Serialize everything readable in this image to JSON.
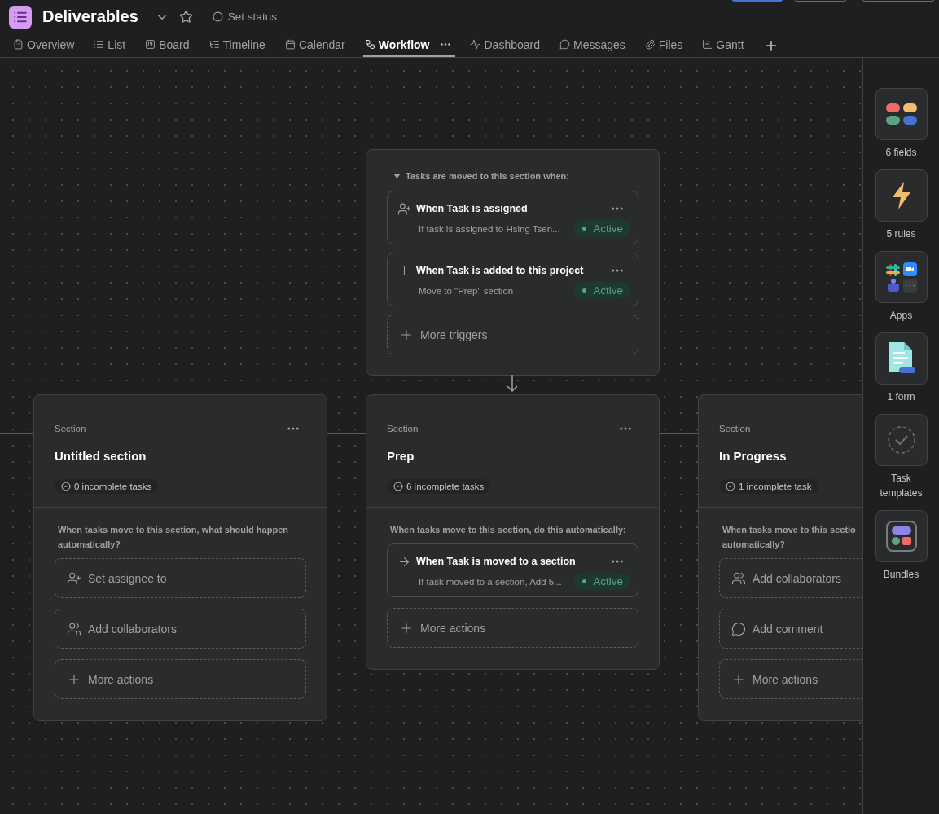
{
  "project": {
    "title": "Deliverables",
    "status_label": "Set status"
  },
  "tabs": [
    {
      "label": "Overview",
      "kind": "overview",
      "selected": false
    },
    {
      "label": "List",
      "kind": "list",
      "selected": false
    },
    {
      "label": "Board",
      "kind": "board",
      "selected": false
    },
    {
      "label": "Timeline",
      "kind": "timeline",
      "selected": false
    },
    {
      "label": "Calendar",
      "kind": "calendar",
      "selected": false
    },
    {
      "label": "Workflow",
      "kind": "workflow",
      "selected": true
    },
    {
      "label": "Dashboard",
      "kind": "dashboard",
      "selected": false
    },
    {
      "label": "Messages",
      "kind": "messages",
      "selected": false
    },
    {
      "label": "Files",
      "kind": "files",
      "selected": false
    },
    {
      "label": "Gantt",
      "kind": "gantt",
      "selected": false
    }
  ],
  "trigger_panel": {
    "heading": "Tasks are moved to this section when:",
    "expanded": true,
    "triggers": [
      {
        "kind": "assign",
        "title": "When Task is assigned",
        "description": "If task is assigned to Hsing Tsen...",
        "status": "Active"
      },
      {
        "kind": "add",
        "title": "When Task is added to this project",
        "description": "Move to \"Prep\" section",
        "status": "Active"
      }
    ],
    "more_label": "More triggers"
  },
  "sections": [
    {
      "label": "Section",
      "title": "Untitled section",
      "count": "0 incomplete tasks",
      "prompt": "When tasks move to this section, what should happen automatically?",
      "actions": [
        {
          "kind": "assignee",
          "label": "Set assignee to"
        },
        {
          "kind": "collaborators",
          "label": "Add collaborators"
        },
        {
          "kind": "more",
          "label": "More actions"
        }
      ]
    },
    {
      "label": "Section",
      "title": "Prep",
      "count": "6 incomplete tasks",
      "prompt": "When tasks move to this section, do this automatically:",
      "rules": [
        {
          "kind": "move",
          "title": "When Task is moved to a section",
          "description": "If task moved to a section, Add 5...",
          "status": "Active"
        }
      ],
      "actions": [
        {
          "kind": "more",
          "label": "More actions"
        }
      ]
    },
    {
      "label": "Section",
      "title": "In Progress",
      "count": "1 incomplete task",
      "prompt": "When tasks move to this sectio\nautomatically?",
      "actions": [
        {
          "kind": "collaborators",
          "label": "Add collaborators"
        },
        {
          "kind": "comment",
          "label": "Add comment"
        },
        {
          "kind": "more",
          "label": "More actions"
        }
      ]
    }
  ],
  "tools": [
    {
      "kind": "fields",
      "label": "6 fields"
    },
    {
      "kind": "rules",
      "label": "5 rules"
    },
    {
      "kind": "apps",
      "label": "Apps"
    },
    {
      "kind": "form",
      "label": "1 form"
    },
    {
      "kind": "templates",
      "label": "Task templates"
    },
    {
      "kind": "bundles",
      "label": "Bundles"
    }
  ]
}
